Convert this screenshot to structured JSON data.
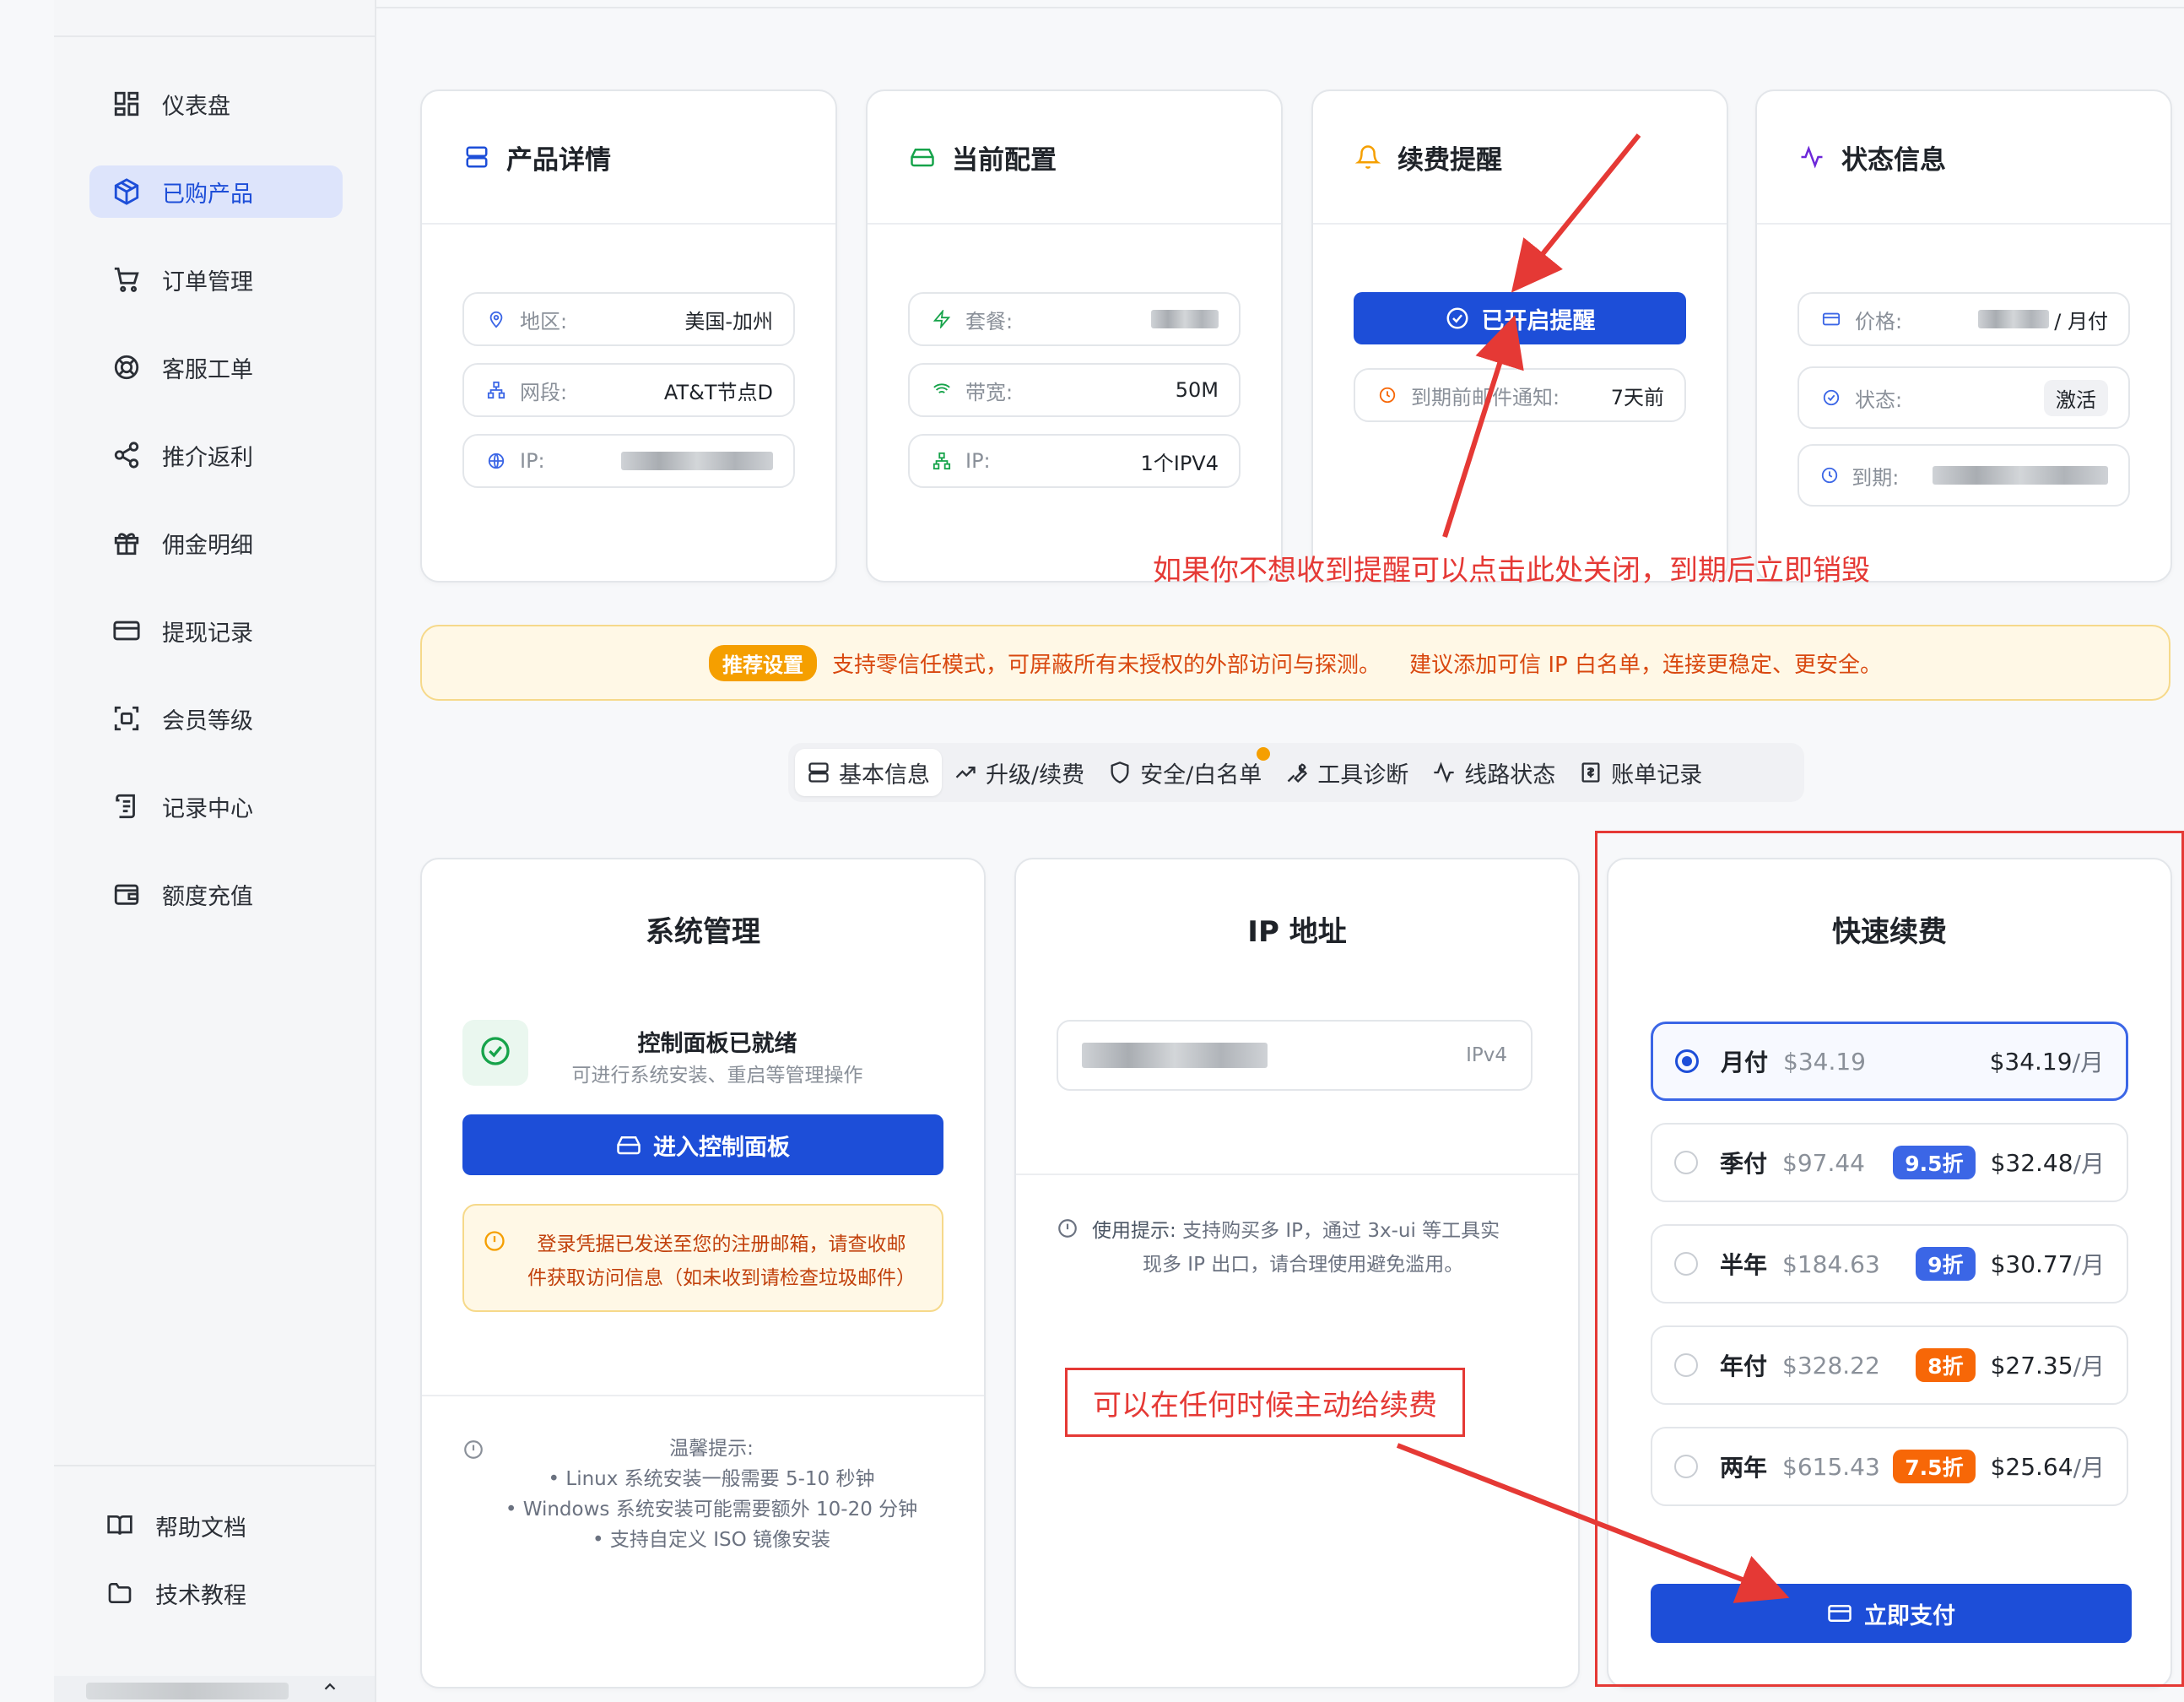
{
  "sidebar": {
    "items": [
      {
        "label": "仪表盘",
        "icon": "dashboard-icon"
      },
      {
        "label": "已购产品",
        "icon": "box-icon",
        "active": true
      },
      {
        "label": "订单管理",
        "icon": "cart-icon"
      },
      {
        "label": "客服工单",
        "icon": "lifebuoy-icon"
      },
      {
        "label": "推介返利",
        "icon": "share-icon"
      },
      {
        "label": "佣金明细",
        "icon": "gift-icon"
      },
      {
        "label": "提现记录",
        "icon": "card-icon"
      },
      {
        "label": "会员等级",
        "icon": "scan-icon"
      },
      {
        "label": "记录中心",
        "icon": "scroll-icon"
      },
      {
        "label": "额度充值",
        "icon": "wallet-icon"
      }
    ],
    "footer": [
      {
        "label": "帮助文档",
        "icon": "book-icon"
      },
      {
        "label": "技术教程",
        "icon": "folder-icon"
      }
    ]
  },
  "product_details": {
    "title": "产品详情",
    "region_label": "地区:",
    "region_value": "美国-加州",
    "segment_label": "网段:",
    "segment_value": "AT&T节点D",
    "ip_label": "IP:"
  },
  "current_config": {
    "title": "当前配置",
    "plan_label": "套餐:",
    "bandwidth_label": "带宽:",
    "bandwidth_value": "50M",
    "ip_label": "IP:",
    "ip_value": "1个IPV4"
  },
  "renewal_reminder": {
    "title": "续费提醒",
    "button_label": "已开启提醒",
    "notice_label": "到期前邮件通知:",
    "notice_value": "7天前"
  },
  "status_info": {
    "title": "状态信息",
    "price_label": "价格:",
    "price_suffix": "/ 月付",
    "status_label": "状态:",
    "status_value": "激活",
    "expire_label": "到期:"
  },
  "recommend": {
    "tag": "推荐设置",
    "text1": "支持零信任模式，可屏蔽所有未授权的外部访问与探测。",
    "text2": "建议添加可信 IP 白名单，连接更稳定、更安全。"
  },
  "tabs": [
    {
      "label": "基本信息",
      "icon": "server-icon",
      "active": true
    },
    {
      "label": "升级/续费",
      "icon": "trend-up-icon"
    },
    {
      "label": "安全/白名单",
      "icon": "shield-icon"
    },
    {
      "label": "工具诊断",
      "icon": "wrench-icon"
    },
    {
      "label": "线路状态",
      "icon": "activity-icon"
    },
    {
      "label": "账单记录",
      "icon": "receipt-icon"
    }
  ],
  "system_management": {
    "title": "系统管理",
    "ready_title": "控制面板已就绪",
    "ready_desc": "可进行系统安装、重启等管理操作",
    "enter_button": "进入控制面板",
    "warn_line1": "登录凭据已发送至您的注册邮箱，请查收邮",
    "warn_line2": "件获取访问信息（如未收到请检查垃圾邮件）",
    "tips_title": "温馨提示:",
    "tips": [
      "• Linux 系统安装一般需要 5-10 秒钟",
      "• Windows 系统安装可能需要额外 10-20 分钟",
      "• 支持自定义 ISO 镜像安装"
    ]
  },
  "ip_address": {
    "title": "IP 地址",
    "ip_type": "IPv4",
    "hint_label": "使用提示:",
    "hint_line1": "支持购买多 IP，通过 3x-ui 等工具实",
    "hint_line2": "现多 IP 出口，请合理使用避免滥用。"
  },
  "quick_renew": {
    "title": "快速续费",
    "plans": [
      {
        "name": "月付",
        "original": "$34.19",
        "discount": "",
        "price": "$34.19",
        "unit": "/月",
        "selected": true
      },
      {
        "name": "季付",
        "original": "$97.44",
        "discount": "9.5折",
        "price": "$32.48",
        "unit": "/月",
        "color": "#3b66e6"
      },
      {
        "name": "半年",
        "original": "$184.63",
        "discount": "9折",
        "price": "$30.77",
        "unit": "/月",
        "color": "#3b66e6"
      },
      {
        "name": "年付",
        "original": "$328.22",
        "discount": "8折",
        "price": "$27.35",
        "unit": "/月",
        "color": "#f76707"
      },
      {
        "name": "两年",
        "original": "$615.43",
        "discount": "7.5折",
        "price": "$25.64",
        "unit": "/月",
        "color": "#f76707"
      }
    ],
    "pay_button": "立即支付"
  },
  "annotations": {
    "reminder_note": "如果你不想收到提醒可以点击此处关闭，到期后立即销毁",
    "renew_note": "可以在任何时候主动给续费",
    "color": "#e53935"
  },
  "colors": {
    "primary": "#1d4ed8",
    "warning": "#f59f00",
    "success": "#16a34a"
  }
}
